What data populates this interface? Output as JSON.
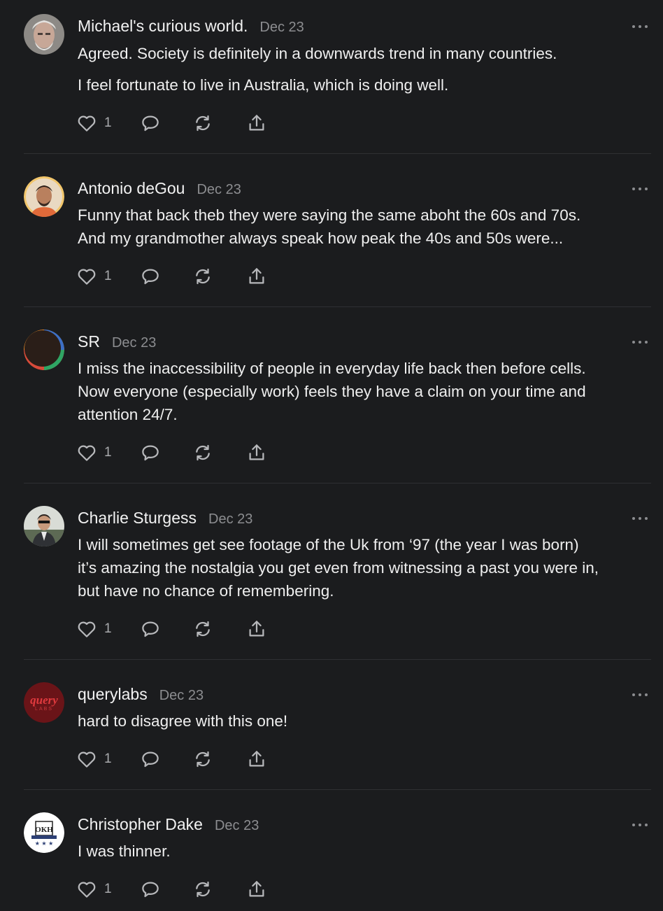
{
  "comments": [
    {
      "author": "Michael's curious world.",
      "date": "Dec 23",
      "lines": [
        "Agreed. Society is definitely in a downwards trend in many countries."
      ],
      "lines2": [
        "I feel fortunate to live in Australia, which is doing well."
      ],
      "likes": "1"
    },
    {
      "author": "Antonio deGou",
      "date": "Dec 23",
      "lines": [
        "Funny that back theb they were saying the same aboht the 60s and 70s.",
        "And my grandmother always speak how peak the 40s and 50s were..."
      ],
      "likes": "1"
    },
    {
      "author": "SR",
      "date": "Dec 23",
      "lines": [
        "I miss the inaccessibility of people in everyday life back then before cells.",
        "Now everyone (especially work) feels they have a claim on your time and",
        "attention 24/7."
      ],
      "likes": "1"
    },
    {
      "author": "Charlie Sturgess",
      "date": "Dec 23",
      "lines": [
        "I will sometimes get see footage of the Uk from ‘97 (the year I was born)",
        "it’s amazing the nostalgia you get even from witnessing a past you were in,",
        "but have no chance of remembering."
      ],
      "likes": "1"
    },
    {
      "author": "querylabs",
      "date": "Dec 23",
      "lines": [
        "hard to disagree with this one!"
      ],
      "likes": "1",
      "avatar_text": "query",
      "avatar_subtext": "LABS"
    },
    {
      "author": "Christopher Dake",
      "date": "Dec 23",
      "lines": [
        "I was thinner."
      ],
      "likes": "1",
      "avatar_text": "OKH"
    }
  ],
  "icons": {
    "like": "heart-icon",
    "reply": "speech-bubble-icon",
    "restack": "restack-icon",
    "share": "share-icon",
    "more": "ellipsis-icon"
  },
  "colors": {
    "background": "#1b1c1e",
    "divider": "#2f3033",
    "meta": "#8c8d90",
    "querylabs_avatar": "#6a1418",
    "querylabs_text": "#e03a3e"
  }
}
